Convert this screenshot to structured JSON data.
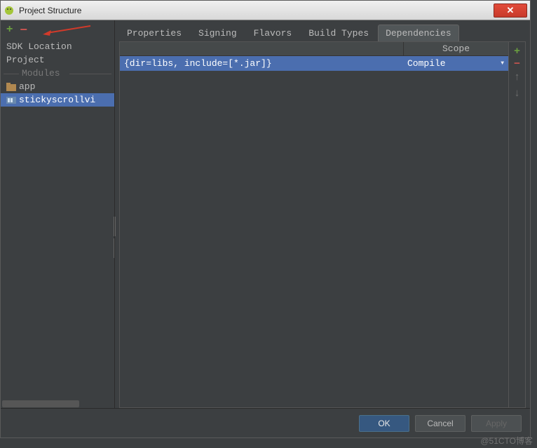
{
  "window": {
    "title": "Project Structure"
  },
  "sidebar": {
    "items": [
      {
        "label": "SDK Location"
      },
      {
        "label": "Project"
      }
    ],
    "section_label": "Modules",
    "modules": [
      {
        "label": "app",
        "selected": false
      },
      {
        "label": "stickyscrollvi",
        "selected": true
      }
    ]
  },
  "tabs": [
    {
      "label": "Properties",
      "active": false
    },
    {
      "label": "Signing",
      "active": false
    },
    {
      "label": "Flavors",
      "active": false
    },
    {
      "label": "Build Types",
      "active": false
    },
    {
      "label": "Dependencies",
      "active": true
    }
  ],
  "dependencies": {
    "header_scope": "Scope",
    "rows": [
      {
        "value": "{dir=libs, include=[*.jar]}",
        "scope": "Compile"
      }
    ]
  },
  "footer": {
    "ok": "OK",
    "cancel": "Cancel",
    "apply": "Apply"
  },
  "watermark": "@51CTO博客"
}
